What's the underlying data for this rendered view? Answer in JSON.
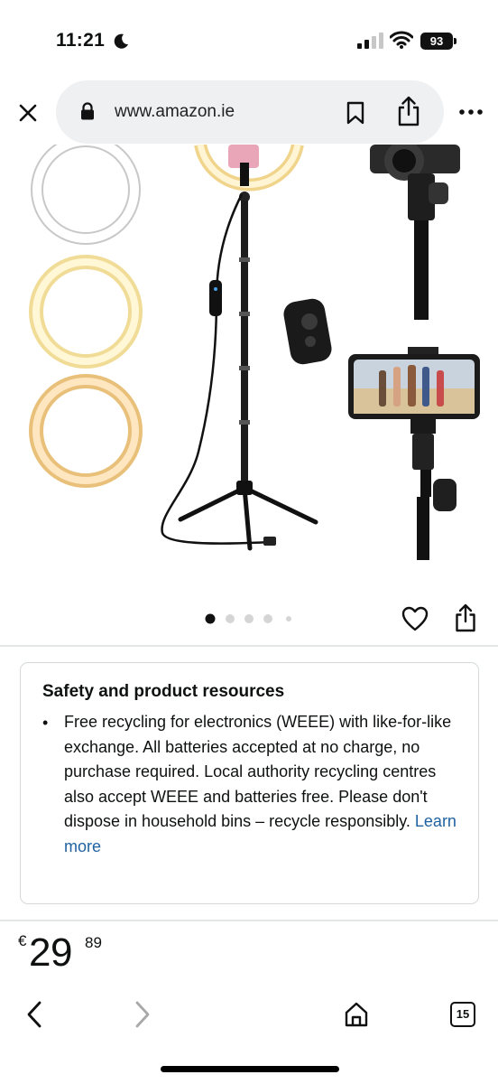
{
  "status_bar": {
    "time": "11:21",
    "battery": "93"
  },
  "browser": {
    "url": "www.amazon.ie",
    "icons": [
      "close-icon",
      "lock-icon",
      "bookmark-icon",
      "share-icon",
      "more-icon"
    ]
  },
  "gallery": {
    "dot_count": 5,
    "active_dot": 1,
    "icons": [
      "heart-icon",
      "share-icon"
    ]
  },
  "safety": {
    "title": "Safety and product resources",
    "body": "Free recycling for electronics (WEEE) with like-for-like exchange. All batteries accepted at no charge, no purchase required. Local authority recycling centres also accept WEEE and batteries free. Please don't dispose in household bins – recycle responsibly.",
    "link": "Learn more"
  },
  "price": {
    "symbol": "€",
    "whole": "29",
    "fraction": "89"
  },
  "toolbar": {
    "tab_count": "15",
    "icons": [
      "chevron-left-icon",
      "chevron-right-icon",
      "home-icon",
      "tabs-icon"
    ]
  },
  "colors": {
    "link": "#2162a1",
    "divider": "#e3e6e6",
    "url_bar": "#eef0f2"
  }
}
